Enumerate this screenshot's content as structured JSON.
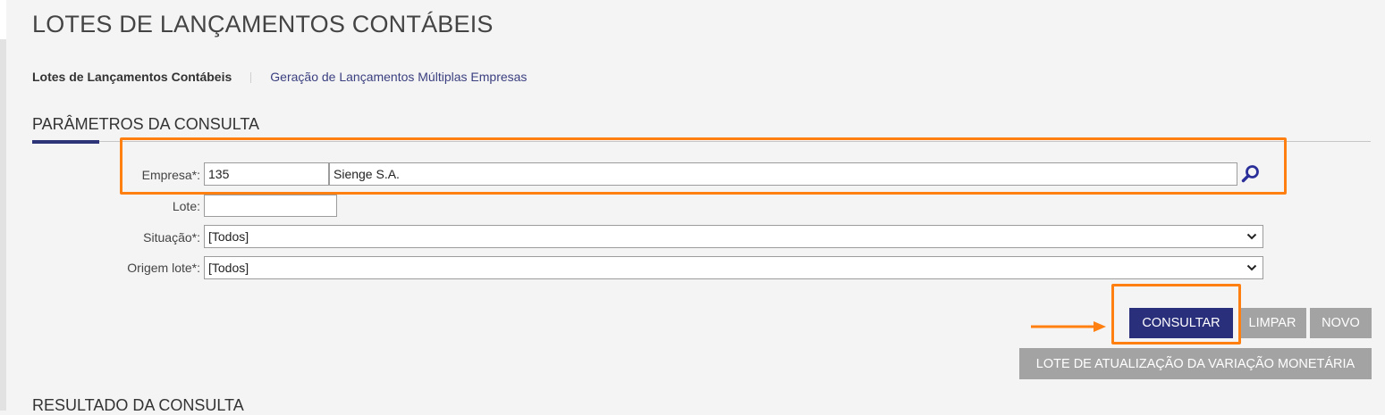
{
  "page": {
    "title": "LOTES DE LANÇAMENTOS CONTÁBEIS"
  },
  "tabs": [
    {
      "label": "Lotes de Lançamentos Contábeis",
      "active": true
    },
    {
      "label": "Geração de Lançamentos Múltiplas Empresas",
      "active": false
    }
  ],
  "sections": {
    "params_title": "PARÂMETROS DA CONSULTA",
    "result_title": "RESULTADO DA CONSULTA"
  },
  "form": {
    "empresa": {
      "label": "Empresa*:",
      "code": "135",
      "name": "Sienge S.A.",
      "search_icon": "magnifier-icon"
    },
    "lote": {
      "label": "Lote:",
      "value": ""
    },
    "situacao": {
      "label": "Situação*:",
      "value": "[Todos]"
    },
    "origem": {
      "label": "Origem lote*:",
      "value": "[Todos]"
    }
  },
  "buttons": {
    "consultar": "CONSULTAR",
    "limpar": "LIMPAR",
    "novo": "NOVO",
    "lote_variacao": "LOTE DE ATUALIZAÇÃO DA VARIAÇÃO MONETÁRIA"
  },
  "colors": {
    "accent": "#2a2f7b",
    "highlight": "#ff7f11",
    "disabled_button": "#a3a3a3",
    "link": "#3a3f7f"
  }
}
